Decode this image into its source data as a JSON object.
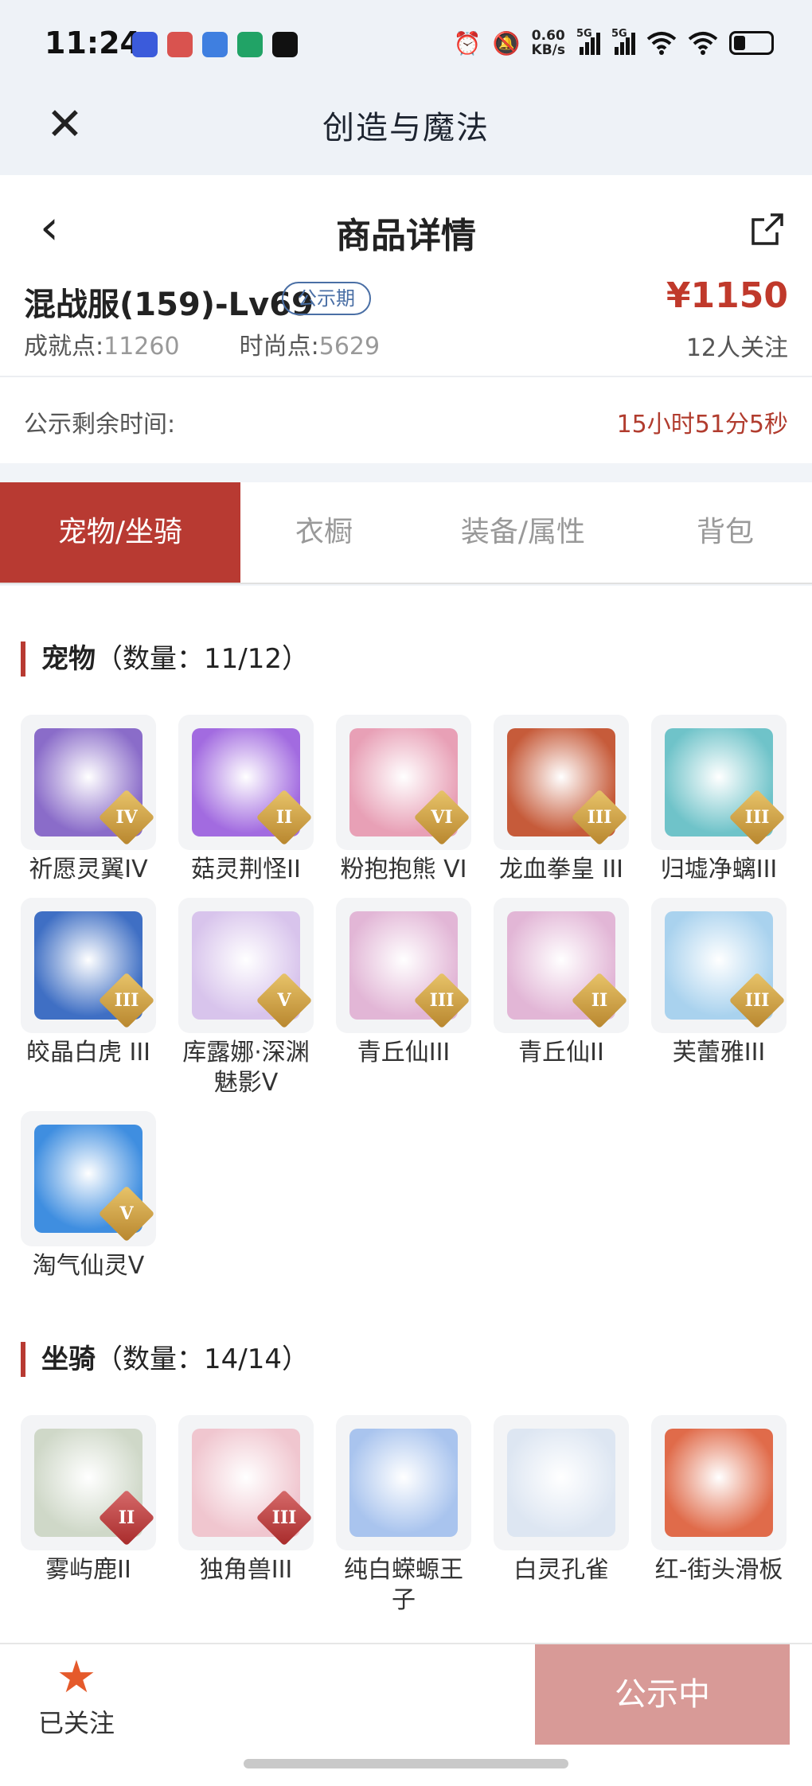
{
  "status_bar": {
    "time": "11:24",
    "net_speed_value": "0.60",
    "net_speed_unit": "KB/s",
    "sim1": "5G",
    "sim2": "5G",
    "app_icons": [
      {
        "name": "vivo-app-icon",
        "color": "#3b5bdb"
      },
      {
        "name": "game-app-icon",
        "color": "#d9534f"
      },
      {
        "name": "blue-app-icon",
        "color": "#3f7fe0"
      },
      {
        "name": "mobile-app-icon",
        "color": "#21a366"
      },
      {
        "name": "music-app-icon",
        "color": "#111111"
      }
    ]
  },
  "app_header": {
    "title": "创造与魔法"
  },
  "nav": {
    "title": "商品详情"
  },
  "product": {
    "server": "混战服(159)-Lv69",
    "badge": "公示期",
    "price": "¥1150",
    "achievement_label": "成就点:",
    "achievement_value": "11260",
    "fashion_label": "时尚点:",
    "fashion_value": "5629",
    "followers": "12人关注"
  },
  "timer": {
    "label": "公示剩余时间:",
    "value": "15小时51分5秒"
  },
  "tabs": [
    {
      "label": "宠物/坐骑",
      "active": true
    },
    {
      "label": "衣橱",
      "active": false
    },
    {
      "label": "装备/属性",
      "active": false
    },
    {
      "label": "背包",
      "active": false
    }
  ],
  "pets": {
    "title": "宠物",
    "count": "（数量：11/12）",
    "items": [
      {
        "name": "祈愿灵翼IV",
        "rank": "IV",
        "color": "#8a6cc9"
      },
      {
        "name": "菇灵荆怪II",
        "rank": "II",
        "color": "#a26be0"
      },
      {
        "name": "粉抱抱熊 VI",
        "rank": "VI",
        "color": "#e8a0b6"
      },
      {
        "name": "龙血拳皇 III",
        "rank": "III",
        "color": "#c65b3a"
      },
      {
        "name": "归墟净螭III",
        "rank": "III",
        "color": "#6fc3c9"
      },
      {
        "name": "皎晶白虎 III",
        "rank": "III",
        "color": "#3f6fc4"
      },
      {
        "name": "库露娜·深渊魅影V",
        "rank": "V",
        "color": "#d8c4ec"
      },
      {
        "name": "青丘仙III",
        "rank": "III",
        "color": "#e2b6d6"
      },
      {
        "name": "青丘仙II",
        "rank": "II",
        "color": "#e2b6d6"
      },
      {
        "name": "芙蕾雅III",
        "rank": "III",
        "color": "#a9d2ee"
      },
      {
        "name": "淘气仙灵V",
        "rank": "V",
        "color": "#3f8ee0"
      }
    ]
  },
  "mounts": {
    "title": "坐骑",
    "count": "（数量：14/14）",
    "items": [
      {
        "name": "雾屿鹿II",
        "rank": "II",
        "color": "#cfd8c8",
        "rank_style": "red"
      },
      {
        "name": "独角兽III",
        "rank": "III",
        "color": "#f0c6cf",
        "rank_style": "red"
      },
      {
        "name": "纯白蝾螈王子",
        "rank": "",
        "color": "#a9c4ee",
        "rank_style": ""
      },
      {
        "name": "白灵孔雀",
        "rank": "",
        "color": "#dde6f2",
        "rank_style": ""
      },
      {
        "name": "红-街头滑板",
        "rank": "",
        "color": "#e06b4a",
        "rank_style": ""
      }
    ]
  },
  "bottom_bar": {
    "follow_label": "已关注",
    "cta_label": "公示中"
  },
  "colors": {
    "accent": "#b83a32",
    "price": "#c0392b",
    "cta_disabled": "#d89a97",
    "badge_blue": "#4a6fa5"
  }
}
